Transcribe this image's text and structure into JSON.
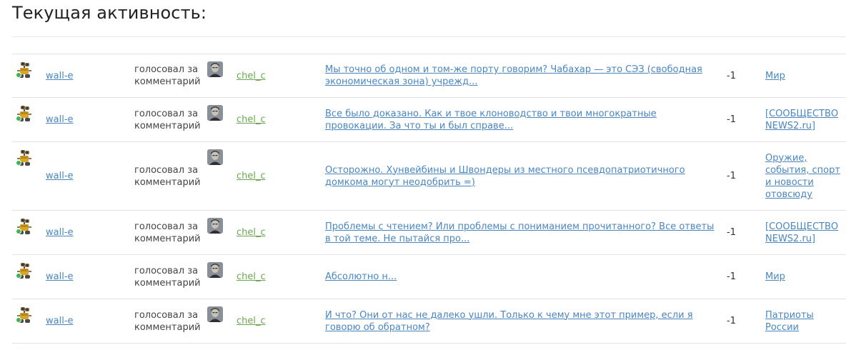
{
  "page": {
    "title": "Текущая активность:"
  },
  "activity": {
    "rows": [
      {
        "user": "wall-e",
        "user_icon": "wall-e-avatar-icon",
        "online": true,
        "action": "голосовал за комментарий",
        "target_user": "chel_c",
        "target_icon": "user-photo-icon",
        "comment": "Мы точно об одном и том-же порту говорим? Чабахар — это СЭЗ (свободная экономическая зона) учрежд...",
        "score": "-1",
        "community": "Мир"
      },
      {
        "user": "wall-e",
        "user_icon": "wall-e-avatar-icon",
        "online": true,
        "action": "голосовал за комментарий",
        "target_user": "chel_c",
        "target_icon": "user-photo-icon",
        "comment": "Все было доказано. Как и твое клоноводство и твои многократные провокации. За что ты и был справе...",
        "score": "-1",
        "community": "[СООБЩЕСТВО NEWS2.ru]"
      },
      {
        "user": "wall-e",
        "user_icon": "wall-e-avatar-icon",
        "online": true,
        "action": "голосовал за комментарий",
        "target_user": "chel_c",
        "target_icon": "user-photo-icon",
        "comment": "Осторожно. Хунвейбины и Швондеры из местного псевдопатриотичного домкома могут неодобрить =)",
        "score": "-1",
        "community": "Оружие, события, спорт и новости отовсюду"
      },
      {
        "user": "wall-e",
        "user_icon": "wall-e-avatar-icon",
        "online": true,
        "action": "голосовал за комментарий",
        "target_user": "chel_c",
        "target_icon": "user-photo-icon",
        "comment": "Проблемы с чтением? Или проблемы с пониманием прочитанного? Все ответы в той теме. Не пытайся про...",
        "score": "-1",
        "community": "[СООБЩЕСТВО NEWS2.ru]"
      },
      {
        "user": "wall-e",
        "user_icon": "wall-e-avatar-icon",
        "online": true,
        "action": "голосовал за комментарий",
        "target_user": "chel_c",
        "target_icon": "user-photo-icon",
        "comment": "Абсолютно н...",
        "score": "-1",
        "community": "Мир"
      },
      {
        "user": "wall-e",
        "user_icon": "wall-e-avatar-icon",
        "online": true,
        "action": "голосовал за комментарий",
        "target_user": "chel_c",
        "target_icon": "user-photo-icon",
        "comment": "И что? Они от нас не далеко ушли. Только к чему мне этот пример, если я говорю об обратном?",
        "score": "-1",
        "community": "Патриоты России"
      }
    ]
  },
  "colors": {
    "link": "#4a86c0",
    "user_link_green": "#6aa84f",
    "online": "#3fb34f",
    "border": "#e2e2e2"
  }
}
